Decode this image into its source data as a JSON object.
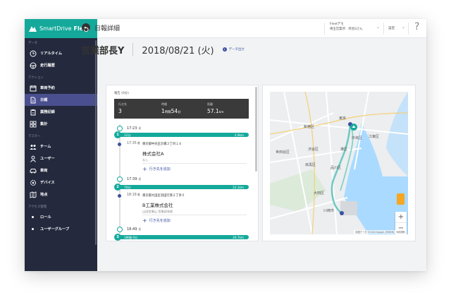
{
  "app": {
    "name": "SmartDrive",
    "name_bold": "Fleet"
  },
  "topbar": {
    "org_line1": "Fleetデモ",
    "org_line2": "埼玉営業所　所長Sさん",
    "settings_label": "設定",
    "help_label": "?"
  },
  "sidebar": {
    "sections": {
      "data": "データ",
      "action": "アクション",
      "master": "マスター",
      "access": "アクセス管理"
    },
    "items": [
      {
        "label": "リアルタイム",
        "icon": "clock-icon"
      },
      {
        "label": "走行履歴",
        "icon": "steering-wheel-icon"
      },
      {
        "label": "車両予約",
        "icon": "calendar-icon"
      },
      {
        "label": "日報",
        "icon": "document-icon",
        "active": true
      },
      {
        "label": "業務記録",
        "icon": "clipboard-icon"
      },
      {
        "label": "集計",
        "icon": "grid-icon"
      },
      {
        "label": "チーム",
        "icon": "team-icon"
      },
      {
        "label": "ユーザー",
        "icon": "user-icon"
      },
      {
        "label": "車両",
        "icon": "car-icon"
      },
      {
        "label": "デバイス",
        "icon": "device-icon"
      },
      {
        "label": "地点",
        "icon": "map-icon"
      },
      {
        "label": "ロール",
        "icon": "dot-icon"
      },
      {
        "label": "ユーザーグループ",
        "icon": "dot-icon"
      }
    ]
  },
  "page": {
    "title": "日報詳細",
    "driver": "営業部長Y",
    "date": "2018/08/21 (火)",
    "export_label": "データ出力"
  },
  "report": {
    "panel_title": "報告 (0分)",
    "summary": {
      "visits_label": "行き先",
      "visits_value": "3",
      "time_label": "時間",
      "time_value_h": "1",
      "time_unit_h": "時間",
      "time_value_m": "54",
      "time_unit_m": "分",
      "distance_label": "距離",
      "distance_value": "57.1",
      "distance_unit": "km"
    },
    "stops": [
      {
        "time": "17:23",
        "unit": "発"
      },
      {
        "time": "17:39",
        "unit": "発"
      },
      {
        "time": "18:49",
        "unit": "発"
      }
    ],
    "segments": [
      {
        "number": "1",
        "duration": "12分",
        "distance": "2.9km"
      },
      {
        "number": "2",
        "duration": "70分",
        "distance": "22.1km"
      },
      {
        "number": "3",
        "duration": "1時間 0分",
        "distance": "26.7km"
      }
    ],
    "visits": [
      {
        "time": "17:35",
        "unit": "着",
        "address": "東京都中央区京橋３丁目１８",
        "name": "株式会社A",
        "memo": "なし",
        "add_label": "行き先を追加"
      },
      {
        "time": "18:18",
        "unit": "着",
        "address": "東京都大田区羽田空港２丁目６",
        "name": "B工業株式会社",
        "memo": "山田営業山 営業部長総",
        "add_label": "行き先を追加"
      }
    ]
  },
  "map": {
    "labels": [
      "東京",
      "新宿区",
      "渋谷区",
      "世田谷区",
      "目黒区",
      "品川区",
      "大田区",
      "川崎市",
      "江東区",
      "中央区",
      "港区"
    ],
    "attribution": "地図データ ©2018 Google, ZENRIN　利用規約",
    "zoom_in": "+",
    "zoom_out": "−",
    "colors": {
      "route": "#6cc9c0",
      "water": "#aadaff",
      "land": "#eceef0",
      "park": "#cfe8c8"
    }
  },
  "colors": {
    "accent": "#14a99b",
    "sidebar": "#24293d",
    "active": "#4a4f8f",
    "link": "#3d4fa0"
  }
}
